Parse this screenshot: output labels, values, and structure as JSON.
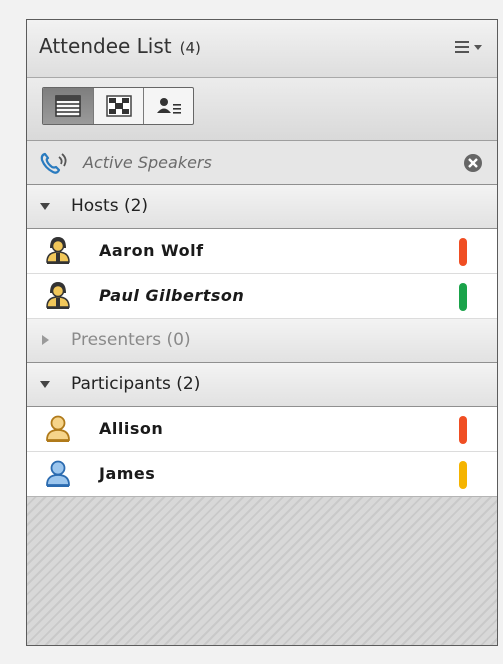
{
  "panel": {
    "title": "Attendee List",
    "count": "(4)",
    "menu_icon": "list-menu-icon"
  },
  "view_modes": [
    {
      "icon": "list-view-icon",
      "active": true
    },
    {
      "icon": "breakout-view-icon",
      "active": false
    },
    {
      "icon": "attendee-detail-icon",
      "active": false
    }
  ],
  "active_speakers": {
    "label": "Active Speakers",
    "icon": "phone-speaker-icon",
    "clear_icon": "close-circle-icon"
  },
  "groups": {
    "hosts": {
      "label": "Hosts (2)",
      "expanded": true,
      "members": [
        {
          "name": "Aaron Wolf",
          "role": "host",
          "status_color": "#f04e23"
        },
        {
          "name": "Paul Gilbertson",
          "role": "host",
          "status_color": "#1aa34a"
        }
      ]
    },
    "presenters": {
      "label": "Presenters (0)",
      "expanded": false
    },
    "participants": {
      "label": "Participants (2)",
      "expanded": true,
      "members": [
        {
          "name": "Allison",
          "role": "participant",
          "status_color": "#f04e23"
        },
        {
          "name": "James",
          "role": "participant",
          "status_color": "#f5b400"
        }
      ]
    }
  }
}
